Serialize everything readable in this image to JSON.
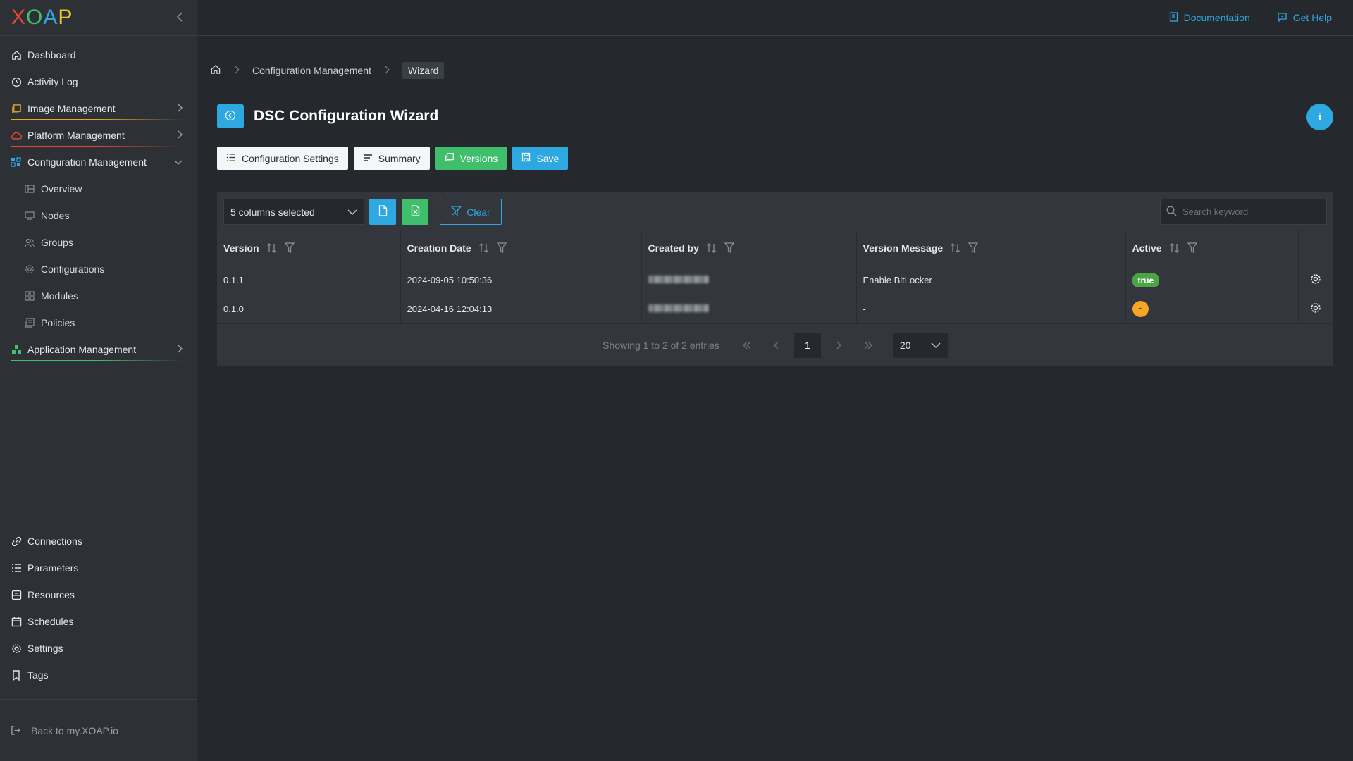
{
  "sidebar": {
    "logo_letters": [
      "X",
      "O",
      "A",
      "P"
    ],
    "logo_colors": [
      "#e0463a",
      "#3fbf6c",
      "#2ea8e0",
      "#e8c630"
    ],
    "items": [
      {
        "label": "Dashboard",
        "icon": "home-icon"
      },
      {
        "label": "Activity Log",
        "icon": "clock-icon"
      },
      {
        "label": "Image Management",
        "icon": "image-icon",
        "color": "#e8a820"
      },
      {
        "label": "Platform Management",
        "icon": "cloud-icon",
        "color": "#e0463a"
      },
      {
        "label": "Configuration Management",
        "icon": "config-icon",
        "color": "#2ea8e0"
      },
      {
        "label": "Overview"
      },
      {
        "label": "Nodes"
      },
      {
        "label": "Groups"
      },
      {
        "label": "Configurations"
      },
      {
        "label": "Modules"
      },
      {
        "label": "Policies"
      },
      {
        "label": "Application Management",
        "icon": "apps-icon",
        "color": "#3fbf6c"
      }
    ],
    "bottom_items": [
      {
        "label": "Connections"
      },
      {
        "label": "Parameters"
      },
      {
        "label": "Resources"
      },
      {
        "label": "Schedules"
      },
      {
        "label": "Settings"
      },
      {
        "label": "Tags"
      }
    ],
    "back_link": "Back to my.XOAP.io"
  },
  "topbar": {
    "documentation": "Documentation",
    "get_help": "Get Help"
  },
  "breadcrumb": {
    "section": "Configuration Management",
    "current": "Wizard"
  },
  "page": {
    "title": "DSC Configuration Wizard",
    "info_label": "i"
  },
  "actions": {
    "configuration_settings": "Configuration Settings",
    "summary": "Summary",
    "versions": "Versions",
    "save": "Save"
  },
  "toolbar": {
    "columns_selected": "5 columns selected",
    "clear": "Clear",
    "search_placeholder": "Search keyword"
  },
  "table": {
    "columns": [
      "Version",
      "Creation Date",
      "Created by",
      "Version Message",
      "Active"
    ],
    "rows": [
      {
        "version": "0.1.1",
        "creation_date": "2024-09-05 10:50:36",
        "version_message": "Enable BitLocker",
        "active": "true"
      },
      {
        "version": "0.1.0",
        "creation_date": "2024-04-16 12:04:13",
        "version_message": "-",
        "active": "-"
      }
    ]
  },
  "pagination": {
    "info": "Showing 1 to 2 of 2 entries",
    "current_page": "1",
    "page_size": "20"
  },
  "colors": {
    "accent_blue": "#2ea8e0",
    "green": "#3fbf6c",
    "badge_true": "#4aa545",
    "badge_dash": "#f5a623"
  }
}
